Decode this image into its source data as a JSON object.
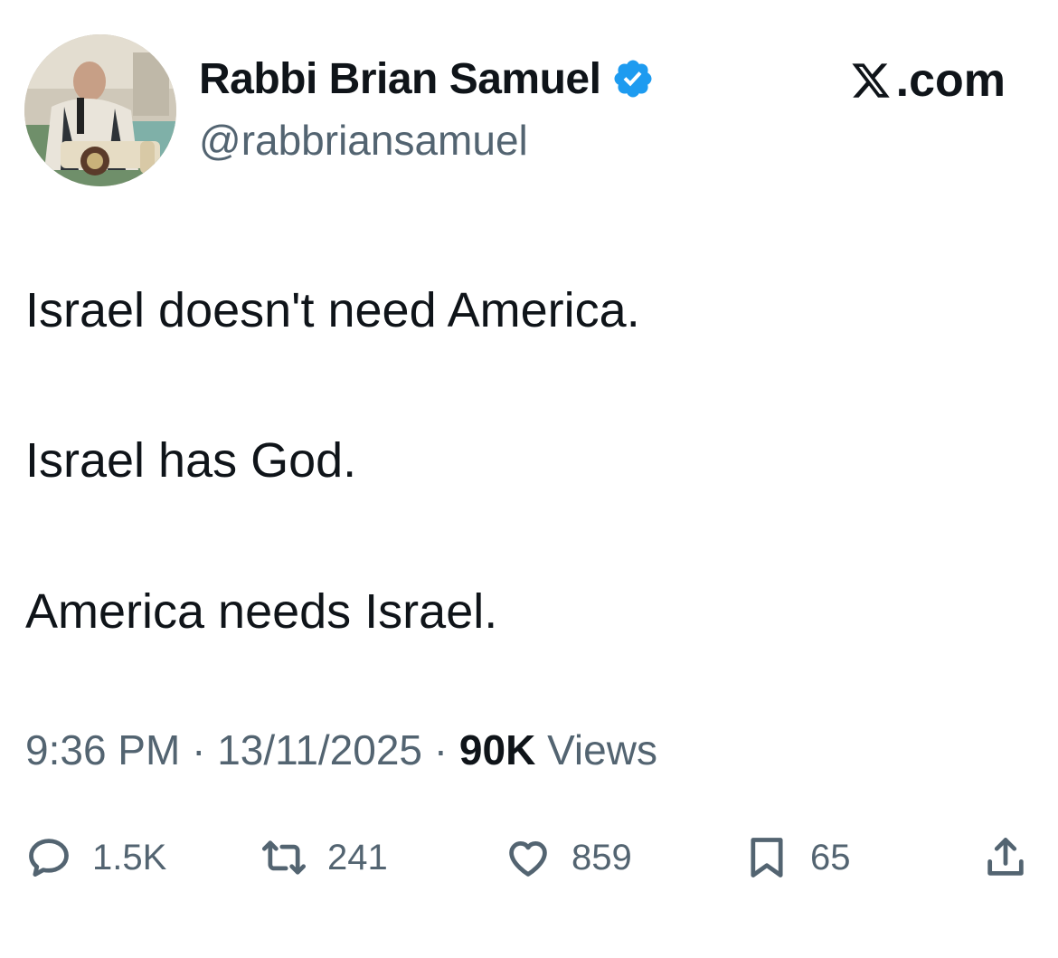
{
  "author": {
    "name": "Rabbi Brian Samuel",
    "handle": "@rabbriansamuel",
    "verified": true,
    "avatar": "avatar-photo"
  },
  "brand": {
    "label": ".com",
    "icon": "x-logo-icon"
  },
  "tweet": {
    "lines": [
      "Israel doesn't need America.",
      "Israel has God.",
      "America needs Israel."
    ]
  },
  "meta": {
    "time": "9:36 PM",
    "separator": "·",
    "date": "13/11/2025",
    "views_count": "90K",
    "views_label": "Views"
  },
  "actions": {
    "replies": {
      "icon": "reply-icon",
      "count": "1.5K"
    },
    "reposts": {
      "icon": "repost-icon",
      "count": "241"
    },
    "likes": {
      "icon": "heart-icon",
      "count": "859"
    },
    "bookmarks": {
      "icon": "bookmark-icon",
      "count": "65"
    },
    "share": {
      "icon": "share-icon"
    }
  },
  "colors": {
    "text_primary": "#0f1419",
    "text_secondary": "#536471",
    "verified_blue": "#1d9bf0"
  }
}
